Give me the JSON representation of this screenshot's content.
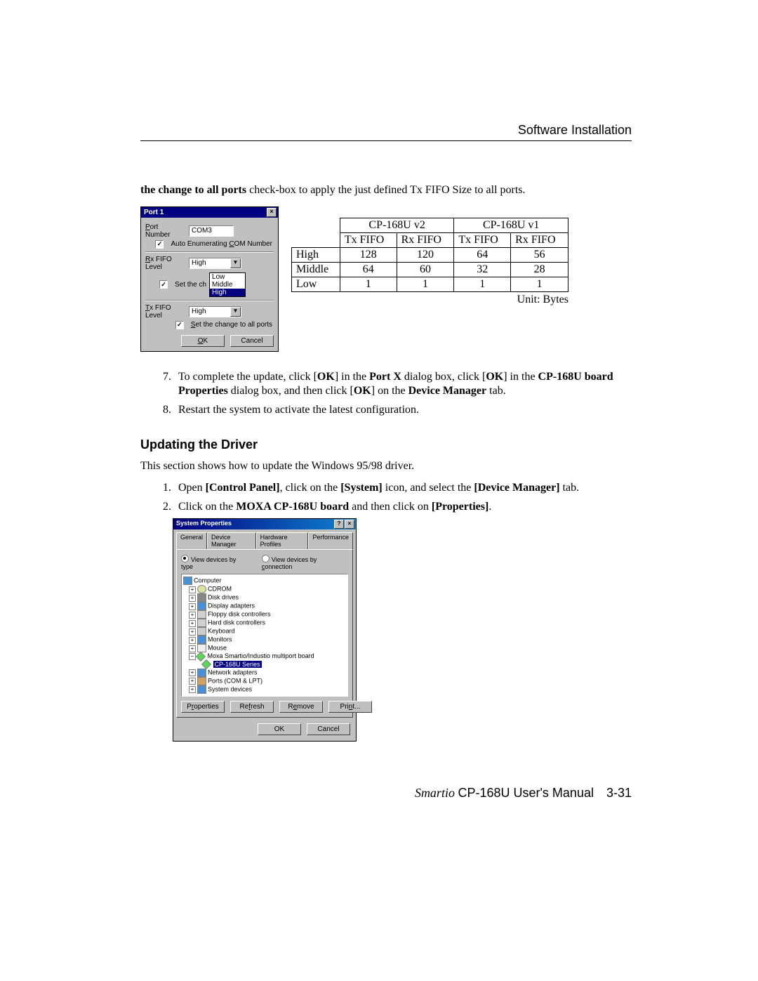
{
  "header": {
    "section_title": "Software Installation"
  },
  "intro": {
    "bold": "the change to all ports",
    "rest": " check-box to apply the just defined Tx FIFO Size to all ports."
  },
  "port_dialog": {
    "title": "Port 1",
    "close": "×",
    "port_number_label": "Port Number",
    "port_number_value": "COM3",
    "auto_enum_label": "Auto Enumerating COM Number",
    "rx_label": "Rx FIFO Level",
    "rx_value": "High",
    "set_change_rx_label": "Set the ch",
    "dropdown": {
      "opt_low": "Low",
      "opt_mid": "Middle",
      "opt_high": "High"
    },
    "tx_label": "Tx FIFO Level",
    "tx_value": "High",
    "set_change_tx_label": "Set the change to all ports",
    "ok": "OK",
    "cancel": "Cancel"
  },
  "fifo_table": {
    "head_v2": "CP-168U v2",
    "head_v1": "CP-168U v1",
    "tx": "Tx FIFO",
    "rx": "Rx FIFO",
    "rows": [
      {
        "label": "High",
        "v2tx": "128",
        "v2rx": "120",
        "v1tx": "64",
        "v1rx": "56"
      },
      {
        "label": "Middle",
        "v2tx": "64",
        "v2rx": "60",
        "v1tx": "32",
        "v1rx": "28"
      },
      {
        "label": "Low",
        "v2tx": "1",
        "v2rx": "1",
        "v1tx": "1",
        "v1rx": "1"
      }
    ],
    "unit": "Unit: Bytes"
  },
  "steps_top": {
    "s7": {
      "pre": "To complete the update, click [",
      "ok1": "OK",
      "mid1": "] in the ",
      "b1": "Port X",
      "mid2": " dialog box, click [",
      "ok2": "OK",
      "mid3": "] in the ",
      "b2": "CP-168U board Properties",
      "mid4": " dialog box, and then click [",
      "ok3": "OK",
      "mid5": "] on the ",
      "b3": "Device Manager",
      "end": " tab."
    },
    "s8": "Restart the system to activate the latest configuration."
  },
  "section2": {
    "heading": "Updating the Driver",
    "intro": "This section shows how to update the Windows 95/98 driver.",
    "s1": {
      "t1": "Open ",
      "b1": "[Control Panel]",
      "t2": ", click on the ",
      "b2": "[System]",
      "t3": " icon, and select the ",
      "b3": "[Device Manager]",
      "t4": " tab."
    },
    "s2": {
      "t1": "Click on the ",
      "b1": "MOXA CP-168U board",
      "t2": " and then click on ",
      "b2": "[Properties]",
      "t3": "."
    }
  },
  "sys_dialog": {
    "title": "System Properties",
    "help": "?",
    "close": "×",
    "tabs": {
      "general": "General",
      "devmgr": "Device Manager",
      "hw": "Hardware Profiles",
      "perf": "Performance"
    },
    "view_type": "View devices by type",
    "view_conn": "View devices by connection",
    "tree": {
      "root": "Computer",
      "n1": "CDROM",
      "n2": "Disk drives",
      "n3": "Display adapters",
      "n4": "Floppy disk controllers",
      "n5": "Hard disk controllers",
      "n6": "Keyboard",
      "n7": "Monitors",
      "n8": "Mouse",
      "n9": "Moxa Smartio/Industio multiport board",
      "n9a": "CP-168U Series",
      "n10": "Network adapters",
      "n11": "Ports (COM & LPT)",
      "n12": "System devices"
    },
    "buttons": {
      "properties": "Properties",
      "refresh": "Refresh",
      "remove": "Remove",
      "print": "Print...",
      "ok": "OK",
      "cancel": "Cancel"
    }
  },
  "footer": {
    "manual": "CP-168U User's Manual",
    "prefix": "Smartio ",
    "page": "3-31"
  }
}
